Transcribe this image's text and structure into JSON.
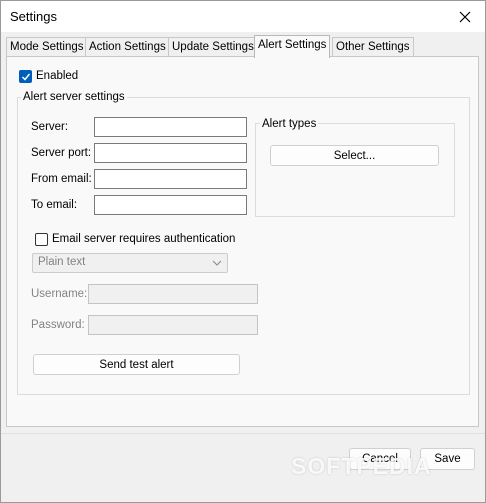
{
  "window": {
    "title": "Settings"
  },
  "tabs": [
    {
      "label": "Mode Settings",
      "active": false
    },
    {
      "label": "Action Settings",
      "active": false
    },
    {
      "label": "Update Settings",
      "active": false
    },
    {
      "label": "Alert Settings",
      "active": true
    },
    {
      "label": "Other Settings",
      "active": false
    }
  ],
  "alert": {
    "enabled_label": "Enabled",
    "enabled_checked": true,
    "server_group_title": "Alert server settings",
    "server_label": "Server:",
    "server_value": "",
    "port_label": "Server port:",
    "port_value": "",
    "from_label": "From email:",
    "from_value": "",
    "to_label": "To email:",
    "to_value": "",
    "types_group_title": "Alert types",
    "select_button": "Select...",
    "auth_label": "Email server requires authentication",
    "auth_checked": false,
    "auth_method_selected": "Plain text",
    "username_label": "Username:",
    "username_value": "",
    "password_label": "Password:",
    "password_value": "",
    "send_test_button": "Send test alert"
  },
  "footer": {
    "cancel": "Cancel",
    "save": "Save"
  },
  "watermark": "SOFTPEDIA",
  "colors": {
    "accent": "#005fb8",
    "panel": "#f9f9f9",
    "window": "#f0f0f0"
  }
}
